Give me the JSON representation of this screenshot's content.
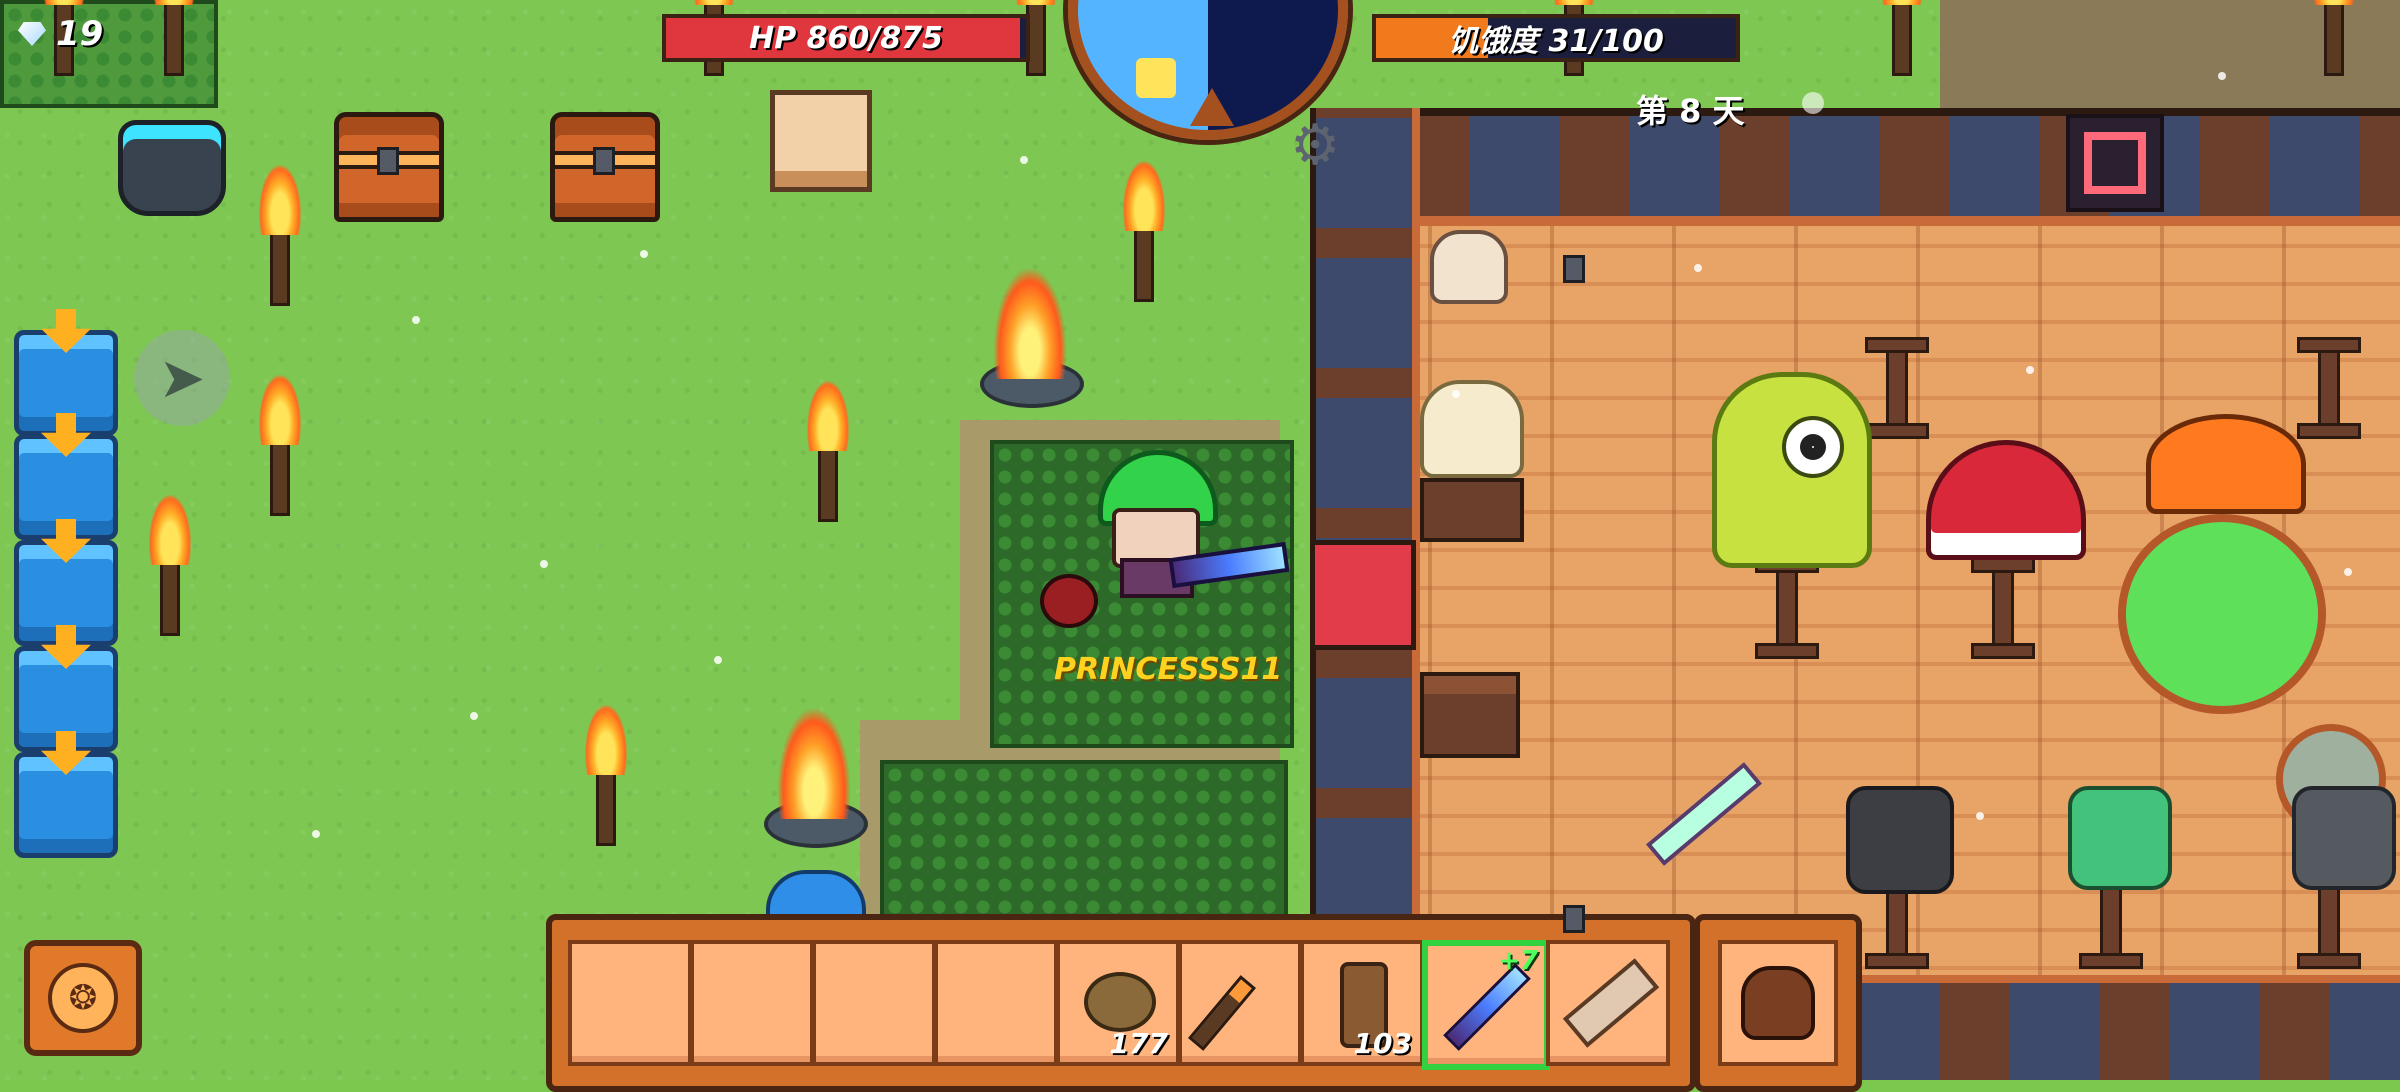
{
  "hud": {
    "gems": "19",
    "hp_text": "HP 860/875",
    "hp_fraction": 0.983,
    "hunger_text": "饥饿度 31/100",
    "hunger_fraction": 0.31,
    "day_text": "第 8 天"
  },
  "player": {
    "name": "PRINCESSS11"
  },
  "hotbar": {
    "slots": [
      {
        "item": "",
        "count": ""
      },
      {
        "item": "",
        "count": ""
      },
      {
        "item": "",
        "count": ""
      },
      {
        "item": "",
        "count": ""
      },
      {
        "item": "stone",
        "count": "177"
      },
      {
        "item": "torch",
        "count": ""
      },
      {
        "item": "wood-plank",
        "count": "103"
      },
      {
        "item": "enchanted-sword",
        "count": "",
        "level": "+7",
        "selected": true
      },
      {
        "item": "scroll",
        "count": ""
      }
    ],
    "bag_item": "leather-bag"
  },
  "colors": {
    "hp": "#e0363d",
    "hunger": "#f07a1c",
    "grass": "#7dc752",
    "selected_slot": "#31d13f"
  }
}
